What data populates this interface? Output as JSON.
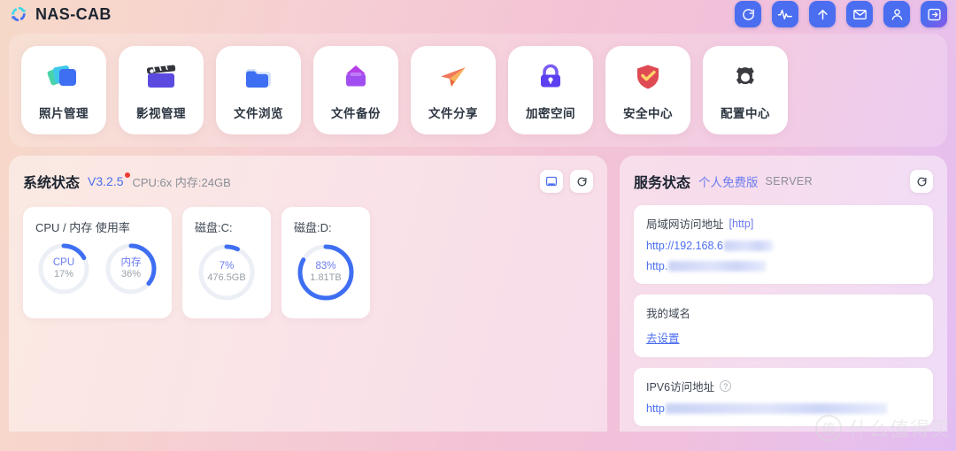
{
  "app": {
    "brand": "NAS-CAB",
    "logo_icon": "sync-circle-icon"
  },
  "topbar": {
    "buttons": [
      {
        "name": "refresh-button",
        "icon": "refresh-icon"
      },
      {
        "name": "activity-button",
        "icon": "pulse-icon"
      },
      {
        "name": "upload-button",
        "icon": "arrow-up-icon"
      },
      {
        "name": "mail-button",
        "icon": "mail-icon"
      },
      {
        "name": "account-button",
        "icon": "user-icon"
      },
      {
        "name": "logout-button",
        "icon": "logout-icon"
      }
    ]
  },
  "apps": [
    {
      "label": "照片管理",
      "icon": "photos-icon"
    },
    {
      "label": "影视管理",
      "icon": "clapperboard-icon"
    },
    {
      "label": "文件浏览",
      "icon": "folder-icon"
    },
    {
      "label": "文件备份",
      "icon": "folder-upload-icon"
    },
    {
      "label": "文件分享",
      "icon": "paper-plane-icon"
    },
    {
      "label": "加密空间",
      "icon": "lock-icon"
    },
    {
      "label": "安全中心",
      "icon": "shield-check-icon"
    },
    {
      "label": "配置中心",
      "icon": "gear-icon"
    }
  ],
  "system": {
    "title": "系统状态",
    "version": "V3.2.5",
    "meta": "CPU:6x 内存:24GB",
    "screen_button_icon": "monitor-icon",
    "refresh_button_icon": "refresh-icon",
    "cards": [
      {
        "title": "CPU / 内存 使用率",
        "gauges": [
          {
            "label": "CPU",
            "value": "17%",
            "percent": 17
          },
          {
            "label": "内存",
            "value": "36%",
            "percent": 36
          }
        ]
      },
      {
        "title": "磁盘:C:",
        "gauges": [
          {
            "label": "7%",
            "value": "476.5GB",
            "percent": 7
          }
        ]
      },
      {
        "title": "磁盘:D:",
        "gauges": [
          {
            "label": "83%",
            "value": "1.81TB",
            "percent": 83
          }
        ]
      }
    ]
  },
  "service": {
    "title": "服务状态",
    "plan": "个人免费版",
    "server": "SERVER",
    "refresh_button_icon": "refresh-icon",
    "rows": [
      {
        "title": "局域网访问地址",
        "tag": "[http]",
        "links": [
          {
            "text": "http://192.168.6",
            "redacted_width": 55
          },
          {
            "text": "http.",
            "redacted_width": 110
          }
        ]
      },
      {
        "title": "我的域名",
        "tag": "",
        "link_text": "去设置"
      },
      {
        "title": "IPV6访问地址",
        "tag": "",
        "help_icon": "question-icon",
        "links": [
          {
            "text": "http",
            "redacted_width": 250
          }
        ]
      }
    ]
  },
  "watermark": {
    "mark": "值",
    "text": "什么值得买"
  }
}
